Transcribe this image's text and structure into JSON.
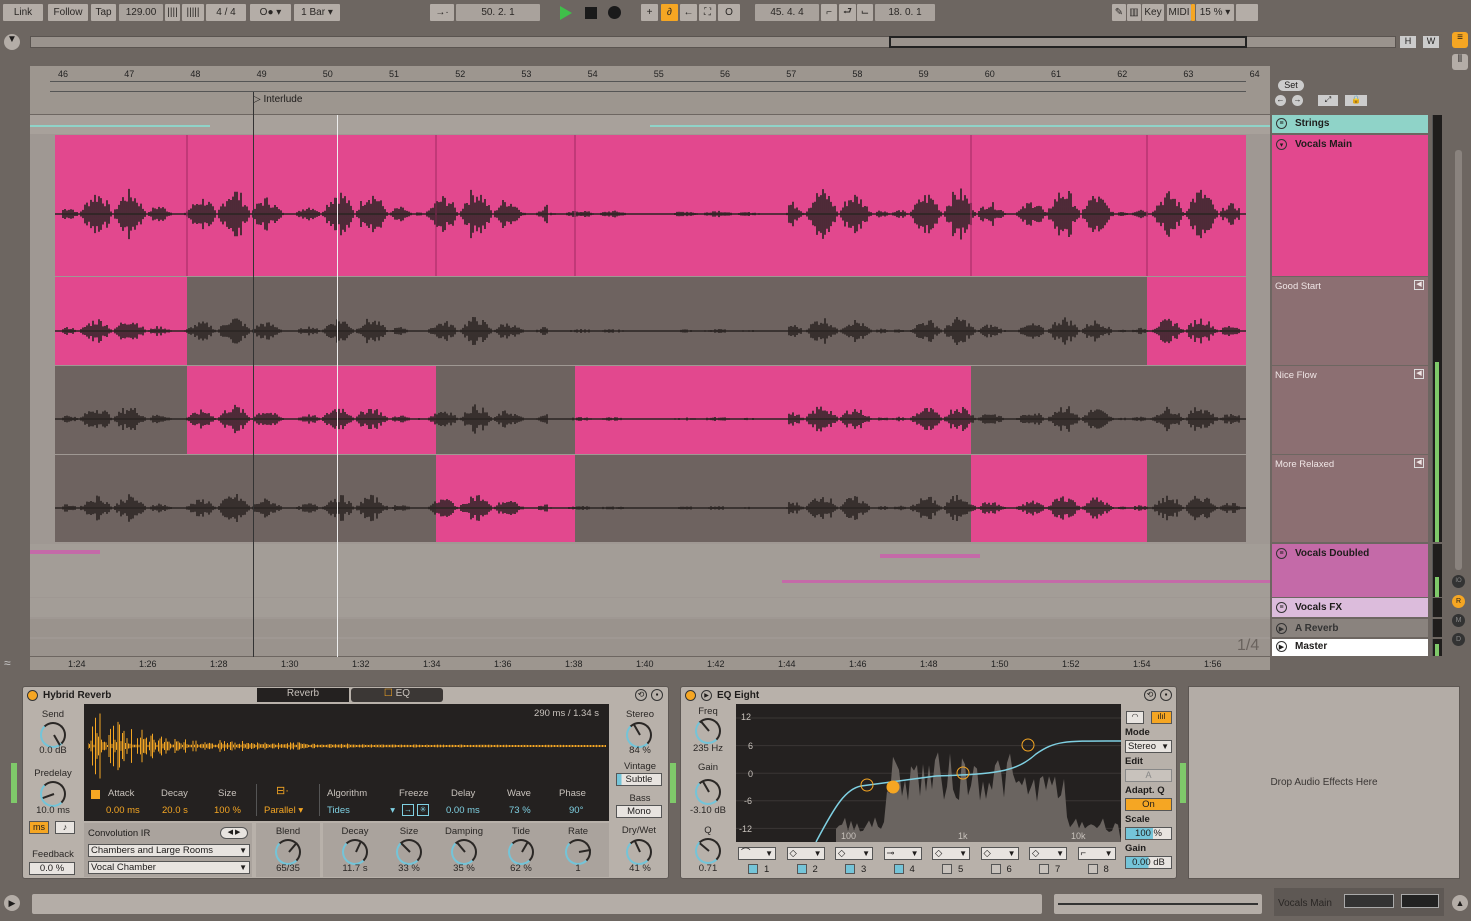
{
  "transport": {
    "link": "Link",
    "follow": "Follow",
    "tap": "Tap",
    "tempo": "129.00",
    "signature": "4 / 4",
    "metronome": "O●",
    "quantize": "1 Bar",
    "position": "50.  2.  1",
    "loop_start": "45.  4.  4",
    "loop_length": "18.  0.  1",
    "key": "Key",
    "midi": "MIDI",
    "cpu": "15 %",
    "play_color": "#3fbf4a",
    "accent": "#f5a623"
  },
  "overview": {
    "h": "H",
    "w": "W"
  },
  "ruler": {
    "bars": [
      "46",
      "47",
      "48",
      "49",
      "50",
      "51",
      "52",
      "53",
      "54",
      "55",
      "56",
      "57",
      "58",
      "59",
      "60",
      "61",
      "62",
      "63",
      "64"
    ],
    "times": [
      "1:24",
      "1:26",
      "1:28",
      "1:30",
      "1:32",
      "1:34",
      "1:36",
      "1:38",
      "1:40",
      "1:42",
      "1:44",
      "1:46",
      "1:48",
      "1:50",
      "1:52",
      "1:54",
      "1:56"
    ],
    "locator": "Interlude",
    "set": "Set",
    "zoom_fraction": "1/4"
  },
  "tracks": {
    "strings": {
      "name": "Strings",
      "color": "#8fd3c8"
    },
    "vocals_main": {
      "name": "Vocals Main",
      "color": "#e2488e"
    },
    "takes": [
      {
        "name": "Good Start"
      },
      {
        "name": "Nice Flow"
      },
      {
        "name": "More Relaxed"
      }
    ],
    "vocals_doubled": {
      "name": "Vocals Doubled",
      "color": "#c46aa8"
    },
    "vocals_fx": {
      "name": "Vocals FX",
      "color": "#dcbcdc"
    },
    "a_reverb": {
      "name": "A Reverb"
    },
    "master": {
      "name": "Master"
    }
  },
  "side_buttons": [
    "IO",
    "R",
    "M",
    "D"
  ],
  "hybrid_reverb": {
    "title": "Hybrid Reverb",
    "tab_reverb": "Reverb",
    "tab_eq": "EQ",
    "ir_time": "290 ms / 1.34 s",
    "send": {
      "label": "Send",
      "value": "0.0 dB"
    },
    "predelay": {
      "label": "Predelay",
      "value": "10.0 ms"
    },
    "ms": "ms",
    "note": "♪",
    "feedback": {
      "label": "Feedback",
      "value": "0.0 %"
    },
    "attack": {
      "label": "Attack",
      "value": "0.00 ms"
    },
    "decay": {
      "label": "Decay",
      "value": "20.0 s"
    },
    "size": {
      "label": "Size",
      "value": "100 %"
    },
    "routing": "Parallel",
    "algorithm": {
      "label": "Algorithm",
      "value": "Tides"
    },
    "freeze": {
      "label": "Freeze"
    },
    "delay": {
      "label": "Delay",
      "value": "0.00 ms"
    },
    "wave": {
      "label": "Wave",
      "value": "73 %"
    },
    "phase": {
      "label": "Phase",
      "value": "90°"
    },
    "stereo": {
      "label": "Stereo",
      "value": "84 %"
    },
    "vintage": {
      "label": "Vintage",
      "value": "Subtle"
    },
    "bass": {
      "label": "Bass",
      "value": "Mono"
    },
    "convolution": {
      "label": "Convolution IR",
      "category": "Chambers and Large Rooms",
      "ir": "Vocal Chamber"
    },
    "blend": {
      "label": "Blend",
      "value": "65/35"
    },
    "algo_decay": {
      "label": "Decay",
      "value": "11.7 s"
    },
    "algo_size": {
      "label": "Size",
      "value": "33 %"
    },
    "damping": {
      "label": "Damping",
      "value": "35 %"
    },
    "tide": {
      "label": "Tide",
      "value": "62 %"
    },
    "rate": {
      "label": "Rate",
      "value": "1"
    },
    "drywet": {
      "label": "Dry/Wet",
      "value": "41 %"
    }
  },
  "eq_eight": {
    "title": "EQ Eight",
    "freq": {
      "label": "Freq",
      "value": "235 Hz"
    },
    "gain": {
      "label": "Gain",
      "value": "-3.10 dB"
    },
    "q": {
      "label": "Q",
      "value": "0.71"
    },
    "db_ticks": [
      "12",
      "6",
      "0",
      "-6",
      "-12"
    ],
    "freq_ticks": [
      "100",
      "1k",
      "10k"
    ],
    "bands": [
      "1",
      "2",
      "3",
      "4",
      "5",
      "6",
      "7",
      "8"
    ],
    "bands_on": [
      true,
      true,
      true,
      true,
      false,
      false,
      false,
      false
    ],
    "mode": {
      "label": "Mode",
      "value": "Stereo"
    },
    "edit": {
      "label": "Edit",
      "value": "A"
    },
    "adapt_q": {
      "label": "Adapt. Q",
      "value": "On"
    },
    "scale": {
      "label": "Scale",
      "value": "100 %"
    },
    "out_gain": {
      "label": "Gain",
      "value": "0.00 dB"
    }
  },
  "drop_hint": "Drop Audio Effects Here",
  "status": {
    "track": "Vocals Main"
  }
}
